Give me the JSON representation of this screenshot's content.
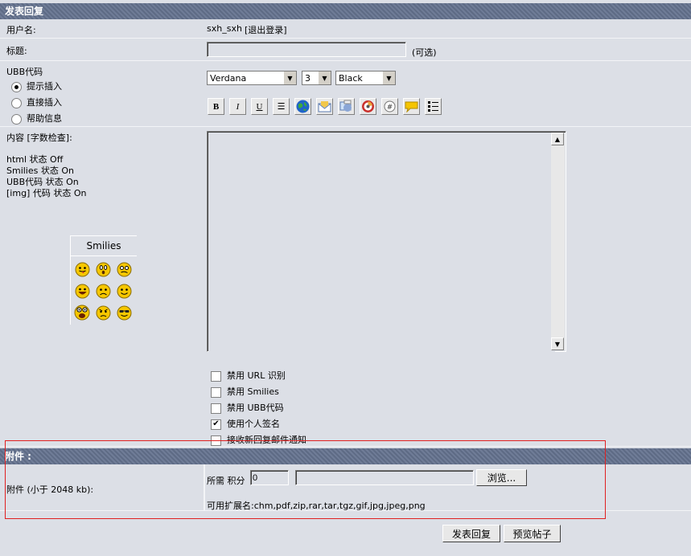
{
  "header": {
    "title": "发表回复"
  },
  "username": {
    "label": "用户名:",
    "value": "sxh_sxh",
    "logout": "[退出登录]"
  },
  "subject": {
    "label": "标题:",
    "value": "",
    "optional": "(可选)"
  },
  "ubb": {
    "label": "UBB代码",
    "modes": [
      {
        "label": "提示插入",
        "selected": true
      },
      {
        "label": "直接插入",
        "selected": false
      },
      {
        "label": "帮助信息",
        "selected": false
      }
    ],
    "font": "Verdana",
    "size": "3",
    "color": "Black",
    "toolbar": [
      "bold-icon",
      "italic-icon",
      "underline-icon",
      "center-icon",
      "globe-icon",
      "email-icon",
      "image-icon",
      "flash-icon",
      "code-icon",
      "quote-icon",
      "list-icon"
    ]
  },
  "content": {
    "label": "内容 [字数检查]:",
    "status": [
      "html 状态 Off",
      "Smilies 状态 On",
      "UBB代码 状态 On",
      "[img] 代码 状态 On"
    ],
    "value": ""
  },
  "smilies": {
    "title": "Smilies",
    "icons": [
      "tongue-smiley-icon",
      "surprised-smiley-icon",
      "confused-smiley-icon",
      "biggrin-smiley-icon",
      "sad-smiley-icon",
      "smile-smiley-icon",
      "laugh-smiley-icon",
      "angry-smiley-icon",
      "cool-smiley-icon"
    ]
  },
  "options": [
    {
      "label": "禁用 URL 识别",
      "checked": false
    },
    {
      "label": "禁用 Smilies",
      "checked": false
    },
    {
      "label": "禁用 UBB代码",
      "checked": false
    },
    {
      "label": "使用个人签名",
      "checked": true
    },
    {
      "label": "接收新回复邮件通知",
      "checked": false
    }
  ],
  "attachment": {
    "header": "附件 :",
    "label": "附件 (小于 2048 kb):",
    "points_label": "所需 积分",
    "points_value": "0",
    "browse": "浏览...",
    "extensions": "可用扩展名:chm,pdf,zip,rar,tar,tgz,gif,jpg,jpeg,png"
  },
  "buttons": {
    "submit": "发表回复",
    "preview": "预览帖子"
  },
  "colors": {
    "header": "#66738e",
    "background": "#dcdfe6",
    "highlight": "#e02020"
  }
}
